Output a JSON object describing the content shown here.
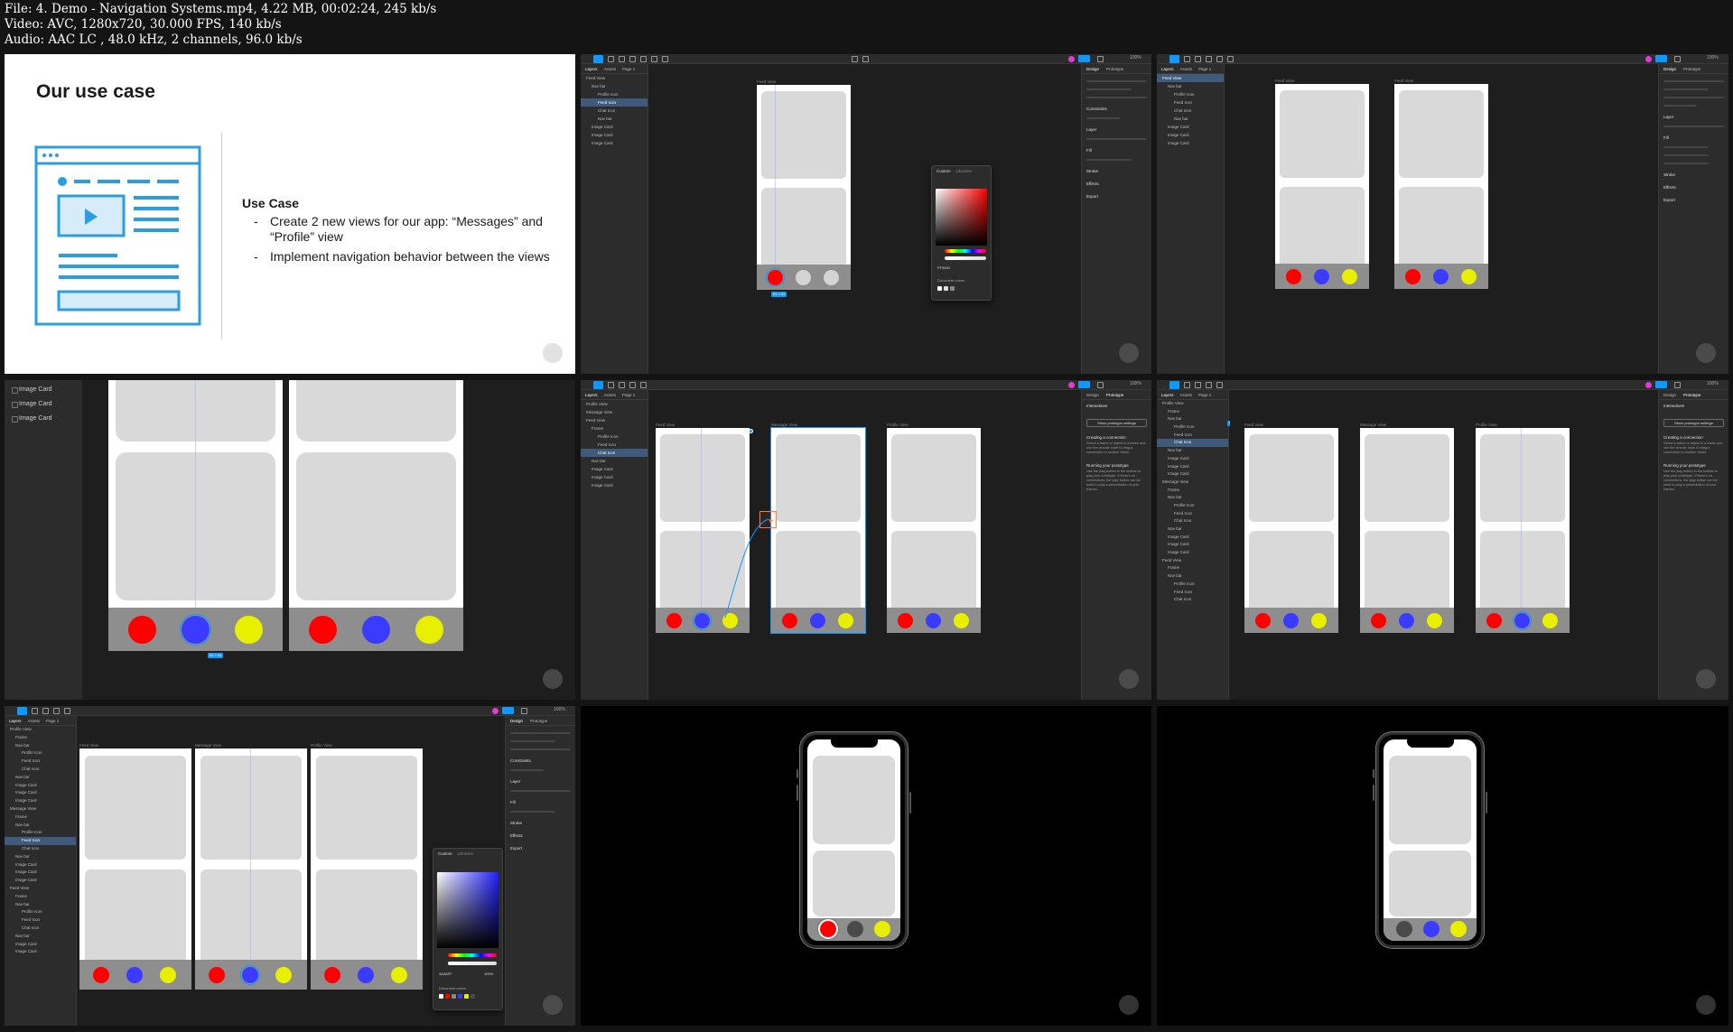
{
  "header": {
    "line1": "File: 4. Demo - Navigation Systems.mp4, 4.22 MB, 00:02:24, 245 kb/s",
    "line2": "Video: AVC, 1280x720, 30.000 FPS, 140 kb/s",
    "line3": "Audio: AAC LC , 48.0 kHz, 2 channels, 96.0 kb/s"
  },
  "slide": {
    "title": "Our use case",
    "heading": "Use Case",
    "items": [
      "Create 2 new views for our app: “Messages” and “Profile” view",
      "Implement navigation behavior between the views"
    ]
  },
  "editor": {
    "layers_tab": "Layers",
    "assets_tab": "Assets",
    "page_tab": "Page 1",
    "design_tab": "Design",
    "prototype_tab": "Prototype",
    "zoom": "100%",
    "layers_a": [
      "Feed View",
      "Nav bar",
      "Profile Icon",
      "Feed Icon",
      "Chat Icon",
      "Nav bar",
      "Image Card",
      "Image Card",
      "Image Card"
    ],
    "layers_b": [
      "Feed View",
      "Nav bar",
      "Profile Icon",
      "Feed Icon",
      "Chat Icon",
      "Nav bar",
      "Image Card",
      "Image Card",
      "Image Card"
    ],
    "layers_c": [
      "Profile View",
      "Message View",
      "Feed View",
      "Frame",
      "Profile Icon",
      "Feed Icon",
      "Chat Icon",
      "Nav bar",
      "Image Card",
      "Image Card",
      "Image Card"
    ],
    "layers_d": [
      "Profile View",
      "Frame",
      "Nav bar",
      "Profile Icon",
      "Feed Icon",
      "Chat Icon",
      "Nav bar",
      "Image Card",
      "Image Card",
      "Image Card",
      "Message View",
      "Frame",
      "Nav bar",
      "Profile Icon",
      "Feed Icon",
      "Chat Icon",
      "Nav bar",
      "Image Card",
      "Image Card",
      "Image Card",
      "Feed View",
      "Frame",
      "Nav bar",
      "Profile Icon",
      "Feed Icon",
      "Chat Icon"
    ],
    "layers_e": [
      "Profile View",
      "Frame",
      "Nav bar",
      "Profile Icon",
      "Feed Icon",
      "Chat Icon",
      "Nav bar",
      "Image Card",
      "Image Card",
      "Image Card",
      "Message View",
      "Frame",
      "Nav bar",
      "Profile Icon",
      "Feed Icon",
      "Chat Icon",
      "Nav bar",
      "Image Card",
      "Image Card",
      "Image Card",
      "Feed View",
      "Frame",
      "Nav bar",
      "Profile Icon",
      "Feed Icon",
      "Chat Icon",
      "Nav bar",
      "Image Card",
      "Image Card"
    ],
    "sections": [
      "Constraints",
      "Layer",
      "Fill",
      "Stroke",
      "Effects",
      "Export"
    ],
    "interactions": "Interactions",
    "proto_settings": "Show prototype settings",
    "connection_title": "Creating a connection",
    "connection_text": "Select a frame or object in a frame and use the circular node to drag a connection to another frame.",
    "preview_title": "Running your prototype",
    "preview_text": "Use the play button in the toolbar to play your prototype. If there's no connections, the play button can be used to play a presentation of your frames.",
    "picker_tab_custom": "Custom",
    "picker_tab_libraries": "Libraries",
    "picker_hex_red": "FF0000",
    "picker_hex_blue": "3A3AFF",
    "picker_opacity": "100%",
    "document_colors": "Document colors",
    "frame_label_feed": "Feed View",
    "frame_label_message": "Message View",
    "frame_label_profile": "Profile View",
    "size_badge": "64 × 64",
    "selected_layer_badge": "View 1",
    "big_layers": [
      "Image Card",
      "Image Card",
      "Image Card"
    ]
  },
  "colors": {
    "red": "#ff0000",
    "blue": "#3b3bff",
    "yellow": "#e8f000",
    "accent": "#0d99ff",
    "slide_blue": "#2a9ee0"
  },
  "icons": [
    "cursor-icon",
    "frame-icon",
    "shape-icon",
    "pen-icon",
    "text-icon",
    "hand-icon",
    "comment-icon",
    "play-icon",
    "camera-icon"
  ]
}
